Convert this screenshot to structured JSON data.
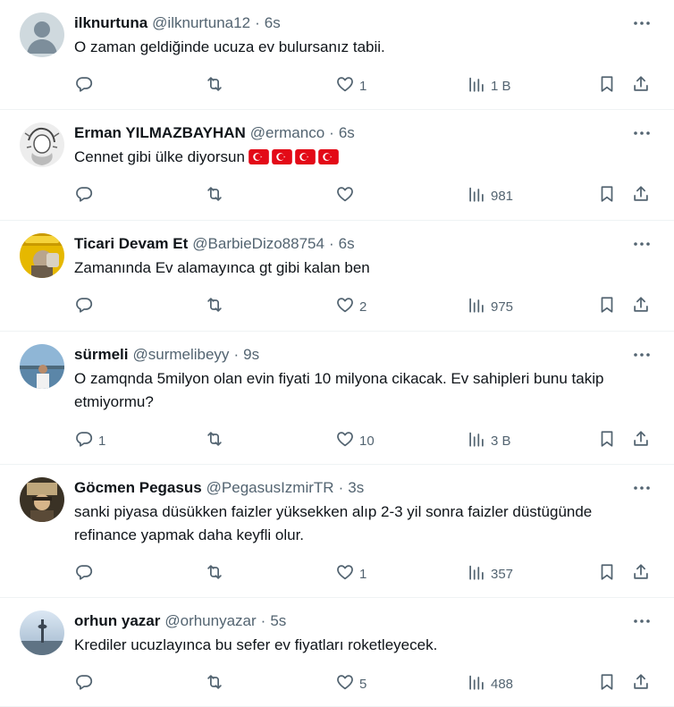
{
  "tweets": [
    {
      "name": "ilknurtuna",
      "handle": "@ilknurtuna12",
      "time": "6s",
      "text": "O zaman geldiğinde ucuza ev bulursanız tabii.",
      "replies": "",
      "retweets": "",
      "likes": "1",
      "views": "1 B",
      "avatar": "default-avatar",
      "flags": 0
    },
    {
      "name": "Erman YILMAZBAYHAN",
      "handle": "@ermanco",
      "time": "6s",
      "text": "Cennet gibi ülke diyorsun",
      "replies": "",
      "retweets": "",
      "likes": "",
      "views": "981",
      "avatar": "sketch-portrait",
      "flags": 4
    },
    {
      "name": "Ticari Devam Et",
      "handle": "@BarbieDizo88754",
      "time": "6s",
      "text": "Zamanında Ev alamayınca gt gibi kalan ben",
      "replies": "",
      "retweets": "",
      "likes": "2",
      "views": "975",
      "avatar": "taxi-photo",
      "flags": 0
    },
    {
      "name": "sürmeli",
      "handle": "@surmelibeyy",
      "time": "9s",
      "text": "O zamqnda 5milyon olan evin fiyati 10 milyona cikacak. Ev sahipleri bunu takip etmiyormu?",
      "replies": "1",
      "retweets": "",
      "likes": "10",
      "views": "3 B",
      "avatar": "seaside-photo",
      "flags": 0
    },
    {
      "name": "Göcmen Pegasus",
      "handle": "@PegasusIzmirTR",
      "time": "3s",
      "text": "sanki piyasa düsükken faizler yüksekken alıp 2-3 yil sonra faizler düstügünde refinance yapmak daha keyfli olur.",
      "replies": "",
      "retweets": "",
      "likes": "1",
      "views": "357",
      "avatar": "vintage-photo",
      "flags": 0
    },
    {
      "name": "orhun yazar",
      "handle": "@orhunyazar",
      "time": "5s",
      "text": "Krediler ucuzlayınca bu sefer ev fiyatları roketleyecek.",
      "replies": "",
      "retweets": "",
      "likes": "5",
      "views": "488",
      "avatar": "tower-photo",
      "flags": 0
    }
  ],
  "colors": {
    "text": "#0f1419",
    "secondary": "#536471",
    "border": "#eff3f4",
    "flag_red": "#e30a17"
  }
}
